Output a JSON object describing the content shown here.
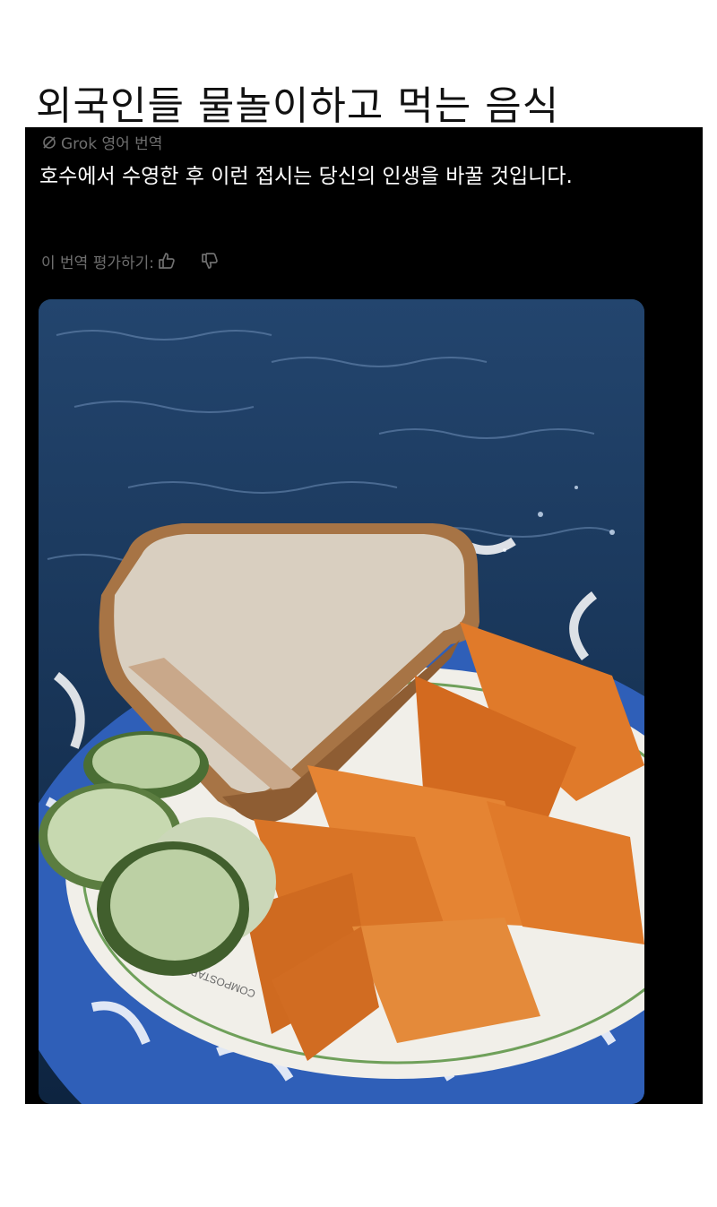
{
  "headline": "외국인들 물놀이하고 먹는 음식",
  "post": {
    "translation_label": "Grok 영어 번역",
    "translation_text": "호수에서 수영한 후 이런 접시는 당신의 인생을 바꿀 것입니다.",
    "rate_label": "이 번역 평가하기:",
    "icons": [
      "grok-icon",
      "thumbs-up-icon",
      "thumbs-down-icon"
    ],
    "colors": {
      "card": "#000000",
      "muted_text": "#6f6f6f",
      "body_text": "#ffffff"
    }
  },
  "photo": {
    "plate_print": "COMPOSTABLE",
    "colors": {
      "water": "#1d3a5f",
      "plate_blue": "#2f5fb8",
      "chips": "#e07a2a",
      "bread": "#d9cfc0",
      "pickle": "#b9cfa0"
    }
  }
}
